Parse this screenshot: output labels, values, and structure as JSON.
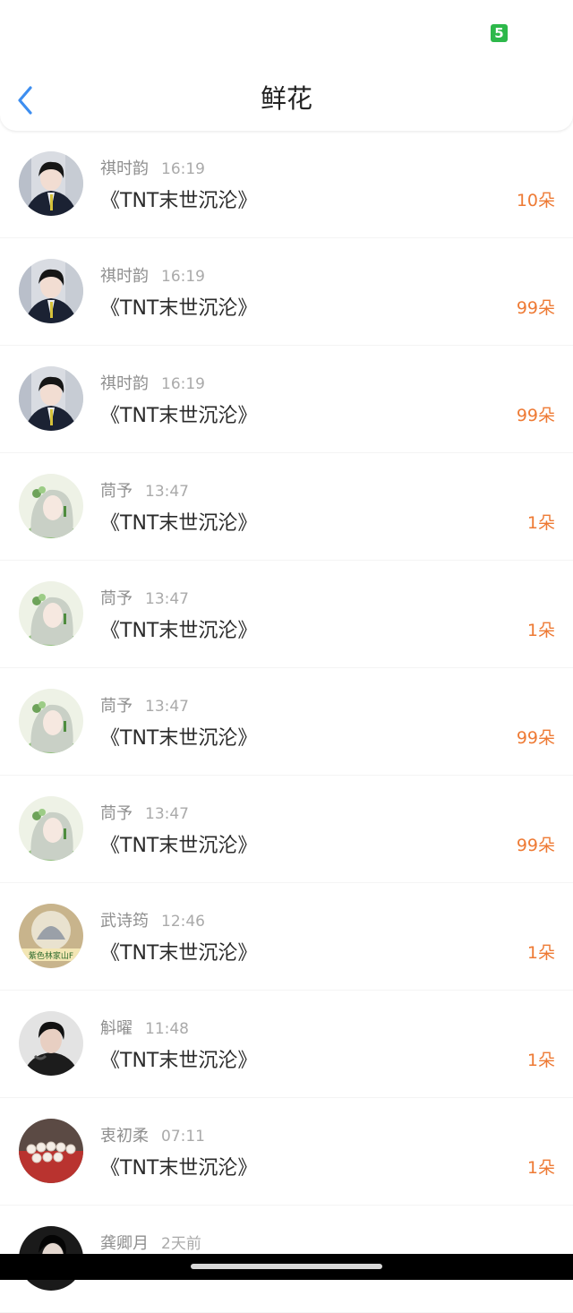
{
  "status_bar": {
    "battery": "5",
    "battery_color": "#2db84a"
  },
  "header": {
    "title": "鲜花",
    "back_icon": "chevron-left-icon",
    "accent": "#3d8ef0"
  },
  "colors": {
    "amount": "#ee7a34",
    "name": "#8f8f8f",
    "time": "#aaaaaa"
  },
  "rows": [
    {
      "name": "祺时韵",
      "time": "16:19",
      "book": "《TNT末世沉沦》",
      "amount": "10朵",
      "avatar": "avatar-boy-suit"
    },
    {
      "name": "祺时韵",
      "time": "16:19",
      "book": "《TNT末世沉沦》",
      "amount": "99朵",
      "avatar": "avatar-boy-suit"
    },
    {
      "name": "祺时韵",
      "time": "16:19",
      "book": "《TNT末世沉沦》",
      "amount": "99朵",
      "avatar": "avatar-boy-suit"
    },
    {
      "name": "茼予",
      "time": "13:47",
      "book": "《TNT末世沉沦》",
      "amount": "1朵",
      "avatar": "avatar-green-girl"
    },
    {
      "name": "茼予",
      "time": "13:47",
      "book": "《TNT末世沉沦》",
      "amount": "1朵",
      "avatar": "avatar-green-girl"
    },
    {
      "name": "茼予",
      "time": "13:47",
      "book": "《TNT末世沉沦》",
      "amount": "99朵",
      "avatar": "avatar-green-girl"
    },
    {
      "name": "茼予",
      "time": "13:47",
      "book": "《TNT末世沉沦》",
      "amount": "99朵",
      "avatar": "avatar-green-girl"
    },
    {
      "name": "武诗筠",
      "time": "12:46",
      "book": "《TNT末世沉沦》",
      "amount": "1朵",
      "avatar": "avatar-text-badge",
      "avatar_text": "紫色林家山F"
    },
    {
      "name": "斛曜",
      "time": "11:48",
      "book": "《TNT末世沉沦》",
      "amount": "1朵",
      "avatar": "avatar-dark-boy"
    },
    {
      "name": "衷初柔",
      "time": "07:11",
      "book": "《TNT末世沉沦》",
      "amount": "1朵",
      "avatar": "avatar-pearls"
    },
    {
      "name": "龚卿月",
      "time": "2天前",
      "book": "",
      "amount": "",
      "avatar": "avatar-dark-girl"
    }
  ]
}
